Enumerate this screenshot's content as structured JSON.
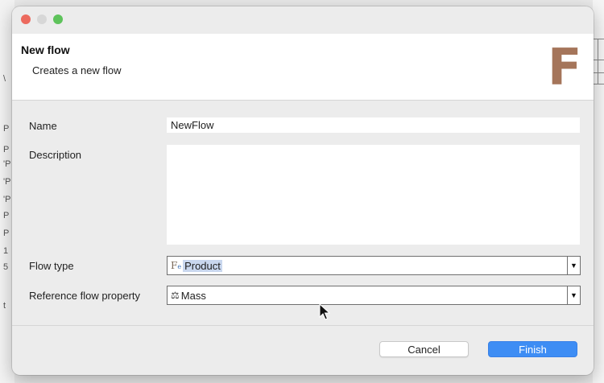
{
  "background": {
    "left_fragments": [
      "P",
      "P",
      "'P",
      "'P",
      "'P",
      "P",
      "P",
      "1",
      "5",
      "t"
    ],
    "partial_label": "\\"
  },
  "banner": {
    "title": "New flow",
    "description": "Creates a new flow",
    "logo_letter": "F"
  },
  "form": {
    "name_label": "Name",
    "name_value": "NewFlow",
    "description_label": "Description",
    "description_value": "",
    "flow_type_label": "Flow type",
    "flow_type_value": "Product",
    "flow_type_icon_main": "F",
    "flow_type_icon_sub": "e",
    "reference_label": "Reference flow property",
    "reference_value": "Mass",
    "reference_icon": "⚖"
  },
  "buttons": {
    "cancel": "Cancel",
    "finish": "Finish"
  },
  "colors": {
    "accent": "#3e8df4",
    "logo": "#a5755a",
    "close": "#ec6a5e",
    "zoom": "#5ec35b"
  }
}
